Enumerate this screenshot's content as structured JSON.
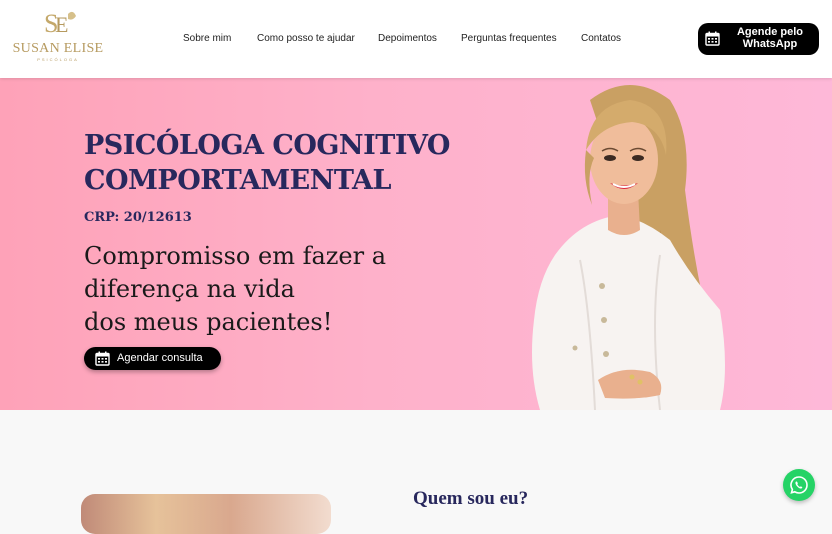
{
  "logo": {
    "monogram": "SE",
    "name": "SUSAN ELISE",
    "subtitle": "PSICÓLOGA"
  },
  "nav": {
    "items": [
      {
        "label": "Sobre mim"
      },
      {
        "label": "Como posso te ajudar"
      },
      {
        "label": "Depoimentos"
      },
      {
        "label": "Perguntas frequentes"
      },
      {
        "label": "Contatos"
      }
    ]
  },
  "header_cta": {
    "label": "Agende pelo WhatsApp",
    "icon": "calendar-icon"
  },
  "hero": {
    "title_line1": "PSICÓLOGA COGNITIVO",
    "title_line2": "COMPORTAMENTAL",
    "crp": "CRP: 20/12613",
    "slogan_line1": "Compromisso em fazer a",
    "slogan_line2": "diferença na vida",
    "slogan_line3": "dos meus pacientes!",
    "cta_label": "Agendar consulta",
    "cta_icon": "calendar-icon"
  },
  "about": {
    "title": "Quem sou eu?"
  },
  "floating_button": {
    "icon": "whatsapp-icon"
  },
  "colors": {
    "navy": "#28285d",
    "gold": "#b69a5f",
    "hero_pink_left": "#fea2b8",
    "hero_pink_right": "#feb8d8",
    "button_black": "#000000",
    "whatsapp_green": "#25d366"
  }
}
